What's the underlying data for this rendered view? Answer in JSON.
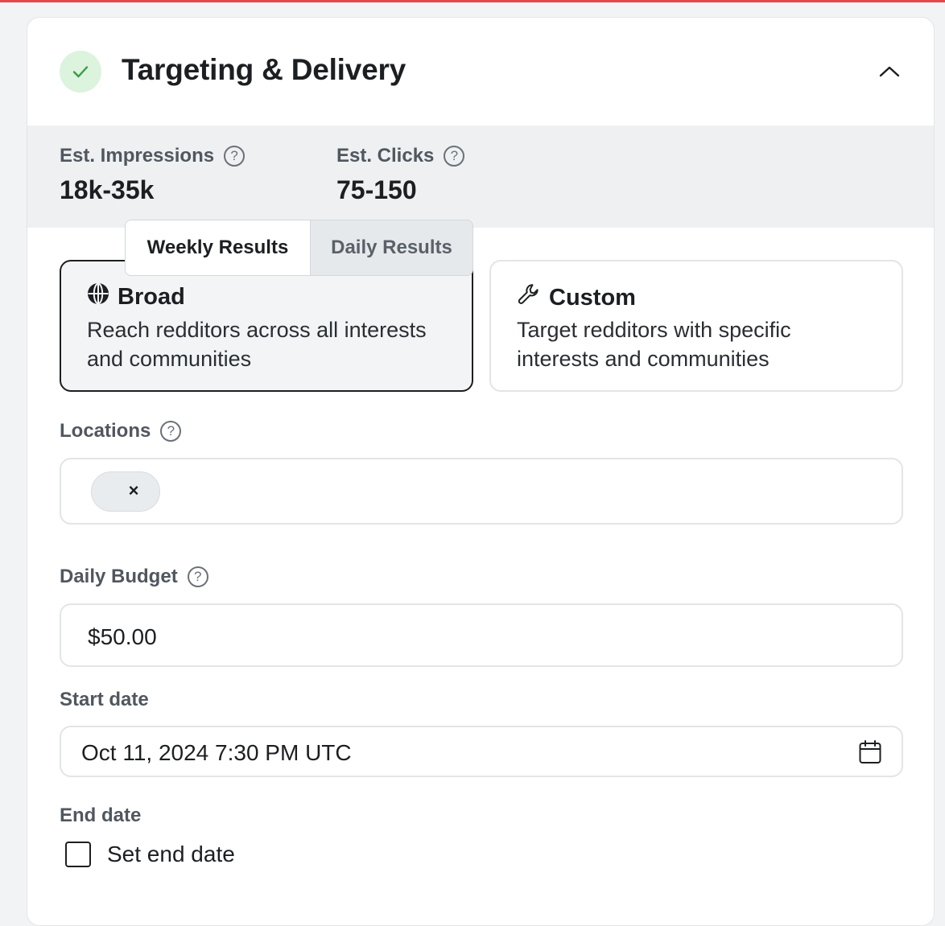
{
  "section": {
    "title": "Targeting & Delivery"
  },
  "estimates": {
    "impressions_label": "Est. Impressions",
    "impressions_value": "18k-35k",
    "clicks_label": "Est. Clicks",
    "clicks_value": "75-150",
    "help_glyph": "?"
  },
  "results_toggle": {
    "weekly": "Weekly Results",
    "daily": "Daily Results",
    "selected": "weekly"
  },
  "targeting_options": {
    "broad": {
      "title": "Broad",
      "description": "Reach redditors across all interests and communities",
      "icon": "globe-icon",
      "selected": true
    },
    "custom": {
      "title": "Custom",
      "description": "Target redditors with specific interests and communities",
      "icon": "wrench-icon",
      "selected": false
    }
  },
  "locations": {
    "label": "Locations",
    "chip_remove": "×"
  },
  "daily_budget": {
    "label": "Daily Budget",
    "value": "$50.00"
  },
  "start_date": {
    "label": "Start date",
    "value": "Oct 11, 2024 7:30 PM UTC"
  },
  "end_date": {
    "label": "End date",
    "checkbox_label": "Set end date",
    "checked": false
  },
  "colors": {
    "accent_green": "#3a9b45",
    "success_bg": "#dcf3dd",
    "top_border": "#e54848"
  }
}
